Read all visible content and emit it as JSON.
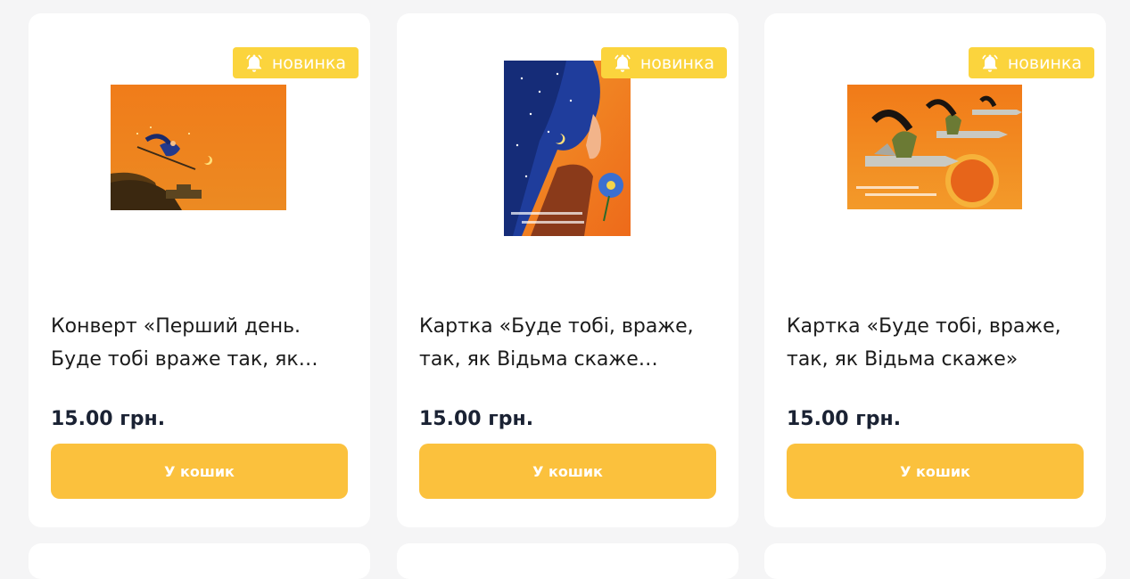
{
  "products": [
    {
      "badge": "новинка",
      "title_line1": "Конверт «Перший день.",
      "title_line2": "Буде тобі враже так, як…",
      "price": "15.00 грн.",
      "cart_label": "У кошик",
      "badge_icon": "bell-icon"
    },
    {
      "badge": "новинка",
      "title_line1": "Картка «Буде тобі, враже,",
      "title_line2": "так, як Відьма скаже…",
      "price": "15.00 грн.",
      "cart_label": "У кошик",
      "badge_icon": "bell-icon"
    },
    {
      "badge": "новинка",
      "title_line1": "Картка «Буде тобі, враже,",
      "title_line2": "так, як Відьма скаже»",
      "price": "15.00 грн.",
      "cart_label": "У кошик",
      "badge_icon": "bell-icon"
    }
  ],
  "colors": {
    "badge": "#fbd43d",
    "button": "#fbc13d",
    "card": "#ffffff",
    "background": "#f5f5f6",
    "price": "#1a2233"
  }
}
